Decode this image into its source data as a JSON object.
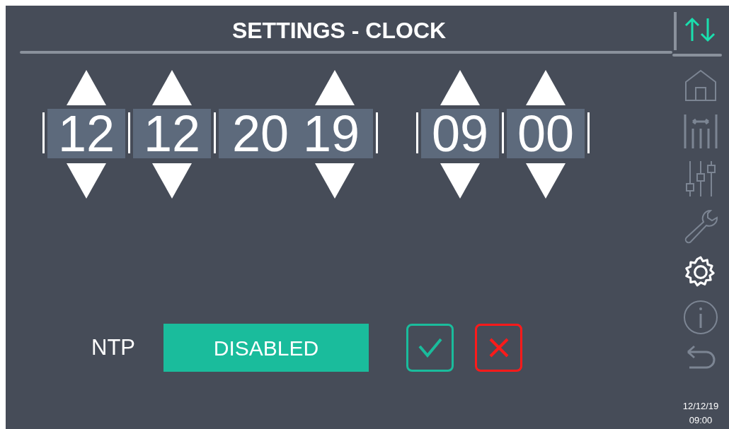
{
  "header": {
    "title": "SETTINGS - CLOCK"
  },
  "date_fields": [
    {
      "value": "12",
      "wide": false
    },
    {
      "value": "12",
      "wide": false
    },
    {
      "value": "20 19",
      "wide": true
    }
  ],
  "time_fields": [
    {
      "value": "09",
      "wide": false
    },
    {
      "value": "00",
      "wide": false
    }
  ],
  "ntp": {
    "label": "NTP",
    "value": "DISABLED"
  },
  "sidebar": {
    "items": [
      {
        "kind": "home",
        "selected": false
      },
      {
        "kind": "levels",
        "selected": false
      },
      {
        "kind": "sliders",
        "selected": false
      },
      {
        "kind": "wrench",
        "selected": false
      },
      {
        "kind": "gear",
        "selected": true
      },
      {
        "kind": "info",
        "selected": false
      },
      {
        "kind": "back",
        "selected": false
      }
    ],
    "date": "12/12/19",
    "time": "09:00"
  }
}
